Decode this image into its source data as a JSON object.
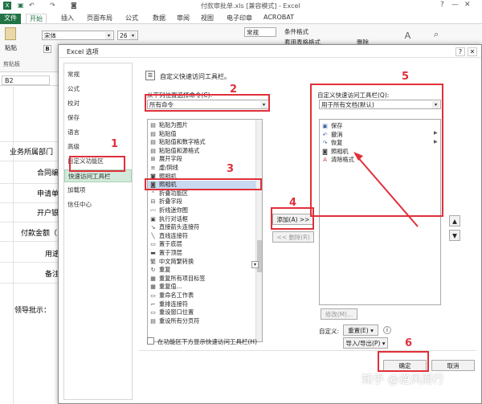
{
  "window": {
    "title": "付款审批单.xls  [兼容模式] - Excel"
  },
  "ribbon": {
    "tabs": [
      "文件",
      "开始",
      "插入",
      "页面布局",
      "公式",
      "数据",
      "审阅",
      "视图",
      "电子印章",
      "ACROBAT"
    ],
    "font_name": "宋体",
    "font_size": "26",
    "number_format": "常规",
    "paste_label": "粘贴",
    "clipboard_label": "剪贴板",
    "cond_format": "条件格式",
    "table_format": "套用表格格式",
    "delete_label": "删除",
    "name_box": "B2"
  },
  "sheet": {
    "labels": [
      "业务所属部门",
      "合同编",
      "申请单",
      "开户银",
      "付款金额（",
      "用途",
      "备注",
      "领导批示："
    ]
  },
  "dialog": {
    "title": "Excel 选项",
    "nav_items": [
      "常规",
      "公式",
      "校对",
      "保存",
      "语言",
      "高级",
      "自定义功能区",
      "快速访问工具栏",
      "加载项",
      "信任中心"
    ],
    "selected_nav": "快速访问工具栏",
    "header": "自定义快速访问工具栏。",
    "choose_label": "从下列位置选择命令(C):",
    "choose_value": "所有命令",
    "customize_label": "自定义快速访问工具栏(Q):",
    "customize_value": "用于所有文档(默认)",
    "command_list": [
      "粘贴为图片",
      "粘贴值",
      "粘贴值和数字格式",
      "粘贴值和源格式",
      "展开字段",
      "虚/阴线",
      "照相机",
      "照相机",
      "折叠功能区",
      "折叠字段",
      "折线迷你图",
      "执行对话框",
      "直接箭头连接符",
      "直线连接符",
      "置于底层",
      "置于顶层",
      "中文简繁转换",
      "重复",
      "重复所有项目标签",
      "重复值...",
      "重命名工作表",
      "重排连接符",
      "重设窗口位置",
      "重设所有分页符"
    ],
    "qat_list": [
      "保存",
      "撤消",
      "恢复",
      "照相机",
      "清除格式"
    ],
    "add_button": "添加(A) >>",
    "remove_button": "<< 删除(R)",
    "modify_button": "修改(M)...",
    "customize_label2": "自定义:",
    "reset_button": "重置(E) ▾",
    "import_export_button": "导入/导出(P) ▾",
    "show_below_label": "在功能区下方显示快速访问工具栏(H)",
    "ok_button": "确定",
    "cancel_button": "取消"
  },
  "annotations": [
    "1",
    "2",
    "3",
    "4",
    "5",
    "6"
  ],
  "watermark": "知乎 @逆风而行",
  "colors": {
    "excel_green": "#217346",
    "annotation_red": "#e0303a",
    "nav_selected": "#d2e9db"
  }
}
